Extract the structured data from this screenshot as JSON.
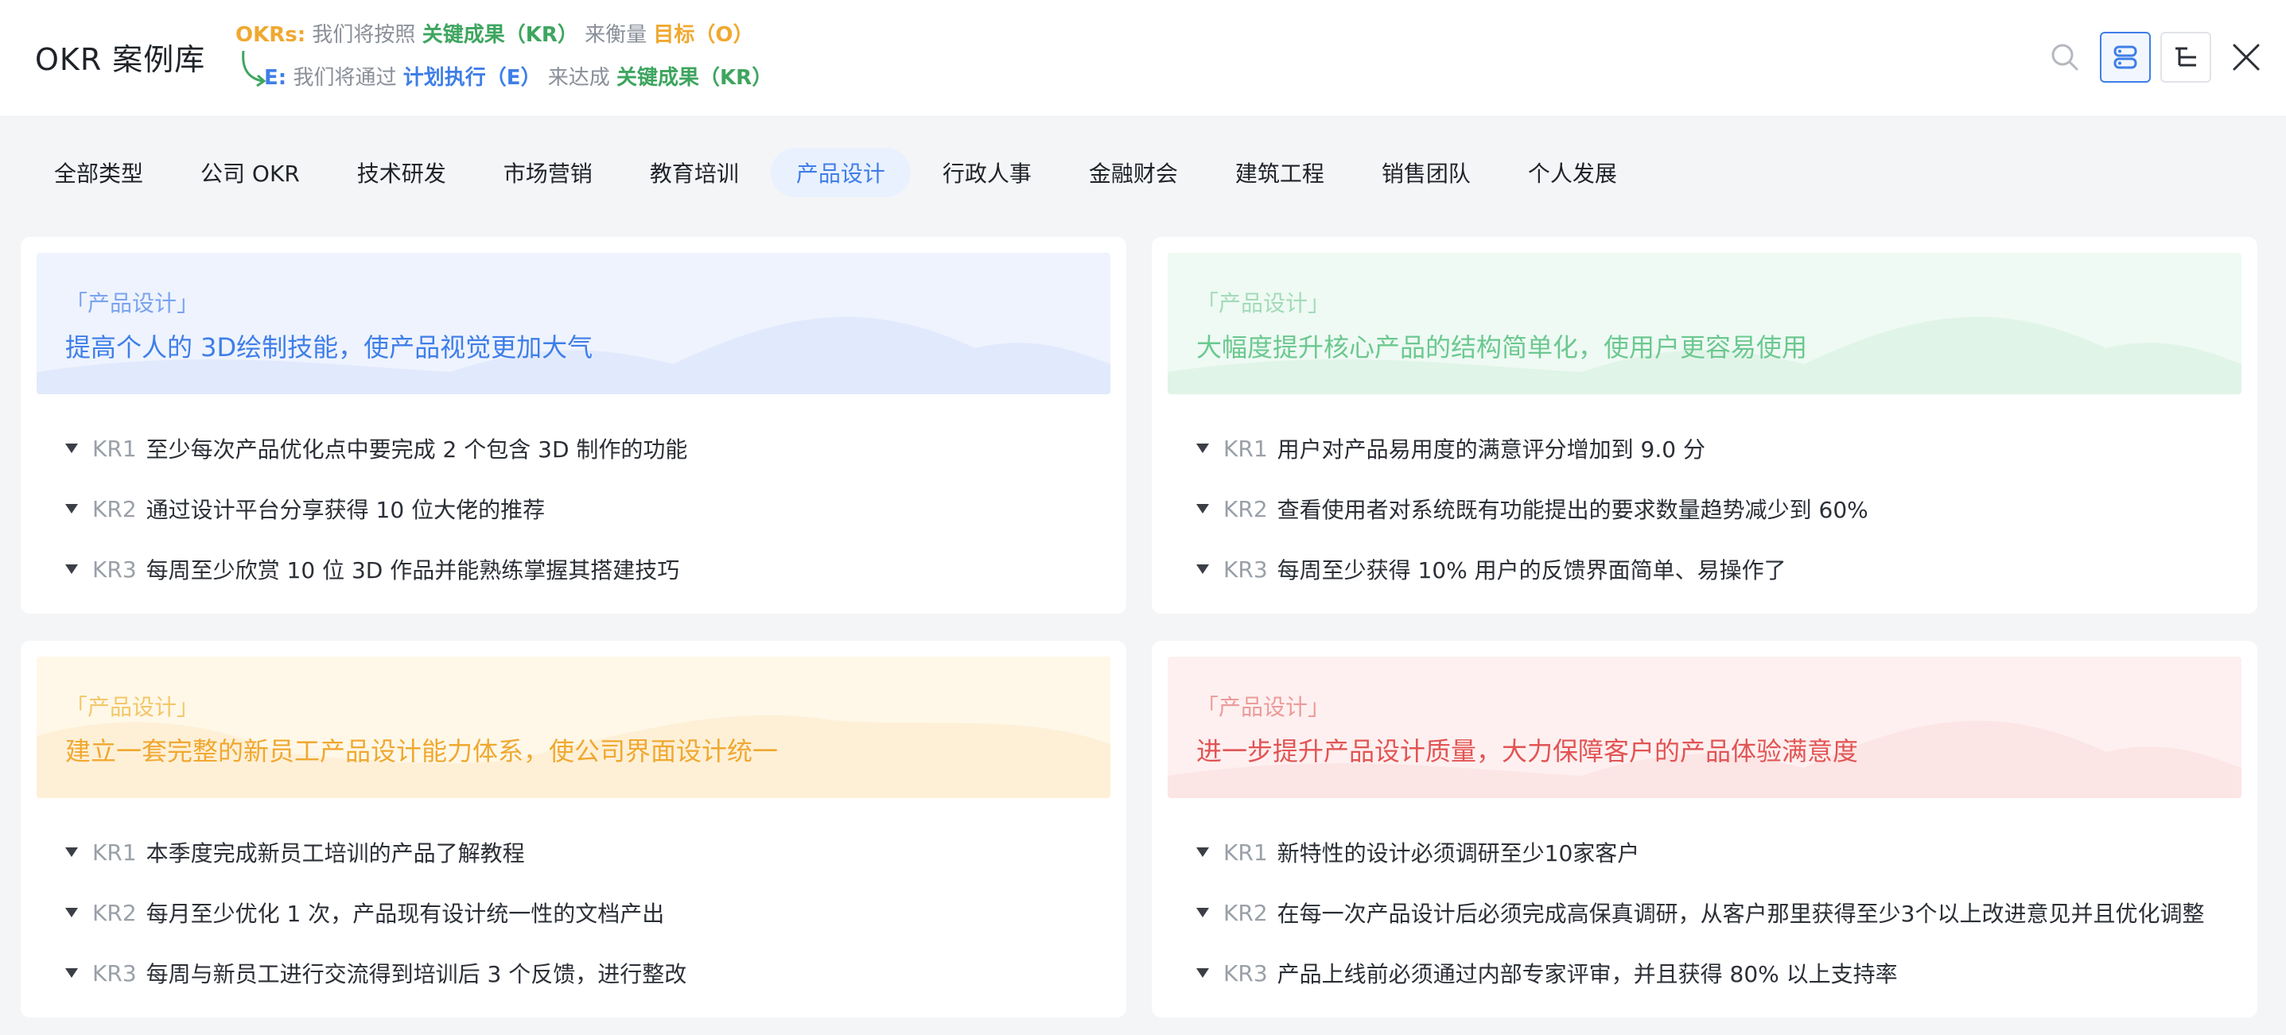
{
  "header": {
    "title": "OKR 案例库",
    "legend_line1": {
      "prefix": "OKRs:",
      "text1": "我们将按照",
      "kr": "关键成果（KR）",
      "text2": "来衡量",
      "objective": "目标（O）"
    },
    "legend_line2": {
      "prefix": "E:",
      "text1": "我们将通过",
      "exec": "计划执行（E）",
      "text2": "来达成",
      "kr": "关键成果（KR）"
    }
  },
  "tabs": [
    {
      "label": "全部类型",
      "active": false
    },
    {
      "label": "公司 OKR",
      "active": false
    },
    {
      "label": "技术研发",
      "active": false
    },
    {
      "label": "市场营销",
      "active": false
    },
    {
      "label": "教育培训",
      "active": false
    },
    {
      "label": "产品设计",
      "active": true
    },
    {
      "label": "行政人事",
      "active": false
    },
    {
      "label": "金融财会",
      "active": false
    },
    {
      "label": "建筑工程",
      "active": false
    },
    {
      "label": "销售团队",
      "active": false
    },
    {
      "label": "个人发展",
      "active": false
    }
  ],
  "cards": [
    {
      "theme": "blue",
      "tag": "「产品设计」",
      "objective": "提高个人的 3D绘制技能，使产品视觉更加大气",
      "krs": [
        {
          "code": "KR1",
          "text": "至少每次产品优化点中要完成 2 个包含 3D 制作的功能"
        },
        {
          "code": "KR2",
          "text": "通过设计平台分享获得 10 位大佬的推荐"
        },
        {
          "code": "KR3",
          "text": "每周至少欣赏 10 位 3D 作品并能熟练掌握其搭建技巧"
        }
      ]
    },
    {
      "theme": "green",
      "tag": "「产品设计」",
      "objective": "大幅度提升核心产品的结构简单化，使用户更容易使用",
      "krs": [
        {
          "code": "KR1",
          "text": "用户对产品易用度的满意评分增加到 9.0 分"
        },
        {
          "code": "KR2",
          "text": "查看使用者对系统既有功能提出的要求数量趋势减少到 60%"
        },
        {
          "code": "KR3",
          "text": "每周至少获得 10% 用户的反馈界面简单、易操作了"
        }
      ]
    },
    {
      "theme": "yellow",
      "tag": "「产品设计」",
      "objective": "建立一套完整的新员工产品设计能力体系，使公司界面设计统一",
      "krs": [
        {
          "code": "KR1",
          "text": "本季度完成新员工培训的产品了解教程"
        },
        {
          "code": "KR2",
          "text": "每月至少优化 1 次，产品现有设计统一性的文档产出"
        },
        {
          "code": "KR3",
          "text": "每周与新员工进行交流得到培训后 3 个反馈，进行整改"
        }
      ]
    },
    {
      "theme": "red",
      "tag": "「产品设计」",
      "objective": "进一步提升产品设计质量，大力保障客户的产品体验满意度",
      "krs": [
        {
          "code": "KR1",
          "text": "新特性的设计必须调研至少10家客户"
        },
        {
          "code": "KR2",
          "text": "在每一次产品设计后必须完成高保真调研，从客户那里获得至少3个以上改进意见并且优化调整"
        },
        {
          "code": "KR3",
          "text": "产品上线前必须通过内部专家评审，并且获得 80% 以上支持率"
        }
      ]
    }
  ],
  "icons": {
    "search": "search-icon",
    "view": "view-toggle-icon",
    "tree": "tree-icon",
    "close": "close-icon"
  },
  "colors": {
    "accent": "#3f7ee8",
    "okr_orange": "#f0a830",
    "kr_green": "#3ea55f"
  }
}
